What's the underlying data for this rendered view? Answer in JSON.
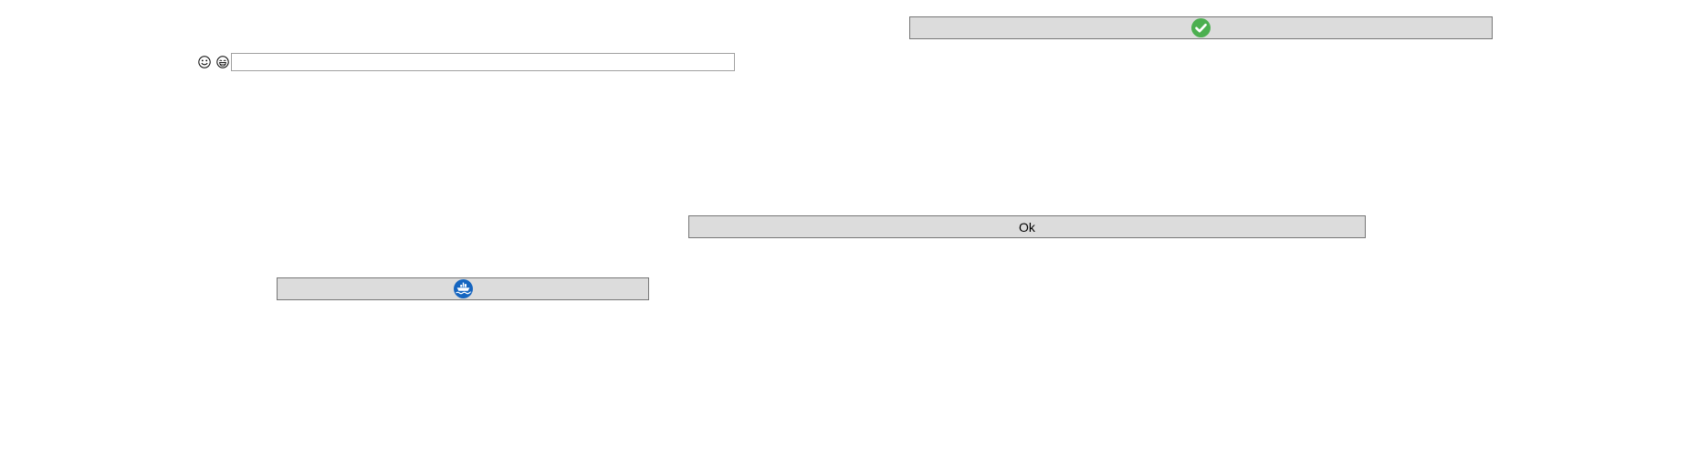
{
  "buttons": {
    "check": {
      "icon": "check-circle-icon",
      "icon_color": "#4caf50"
    },
    "ok": {
      "label": "Ok"
    },
    "ship": {
      "icon": "ship-at-sea-icon",
      "icon_color": "#1565c0"
    }
  },
  "emojis": [
    {
      "icon": "smiling-face-icon"
    },
    {
      "icon": "grinning-face-icon"
    }
  ],
  "text_field": {
    "value": "",
    "placeholder": ""
  }
}
